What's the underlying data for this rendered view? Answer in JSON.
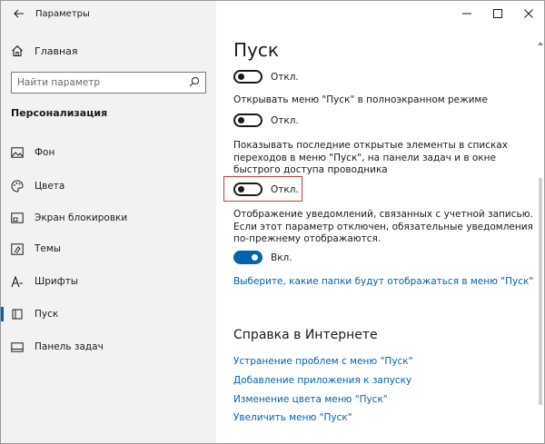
{
  "window": {
    "title": "Параметры"
  },
  "sidebar": {
    "home_label": "Главная",
    "search_placeholder": "Найти параметр",
    "section_heading": "Персонализация",
    "items": [
      {
        "label": "Фон",
        "icon": "picture-icon"
      },
      {
        "label": "Цвета",
        "icon": "palette-icon"
      },
      {
        "label": "Экран блокировки",
        "icon": "lock-screen-icon"
      },
      {
        "label": "Темы",
        "icon": "themes-icon"
      },
      {
        "label": "Шрифты",
        "icon": "fonts-icon"
      },
      {
        "label": "Пуск",
        "icon": "start-icon",
        "active": true
      },
      {
        "label": "Панель задач",
        "icon": "taskbar-icon"
      }
    ]
  },
  "main": {
    "title": "Пуск",
    "toggle1": {
      "state": "Откл."
    },
    "setting2": {
      "text": "Открывать меню \"Пуск\" в полноэкранном режиме",
      "state": "Откл."
    },
    "setting3": {
      "text": "Показывать последние открытые элементы в списках переходов в меню \"Пуск\", на панели задач и в окне быстрого доступа проводника",
      "state": "Откл."
    },
    "setting4": {
      "text": "Отображение уведомлений, связанных с учетной записью. Если этот параметр отключен, обязательные уведомления по-прежнему отображаются.",
      "state": "Вкл."
    },
    "folders_link": "Выберите, какие папки будут отображаться в меню \"Пуск\"",
    "help_heading": "Справка в Интернете",
    "help_links": [
      "Устранение проблем с меню \"Пуск\"",
      "Добавление приложения к запуску",
      "Изменение цвета меню \"Пуск\"",
      "Увеличить меню \"Пуск\""
    ]
  },
  "colors": {
    "accent": "#0063b1",
    "highlight": "#d9343a",
    "sidebar_bg": "#f2f2f2"
  }
}
